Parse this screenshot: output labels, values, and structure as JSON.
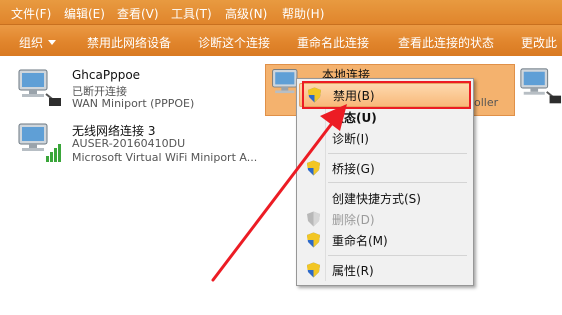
{
  "menubar": {
    "items": [
      "文件(F)",
      "编辑(E)",
      "查看(V)",
      "工具(T)",
      "高级(N)",
      "帮助(H)"
    ]
  },
  "toolbar": {
    "organize": "组织",
    "buttons": [
      "禁用此网络设备",
      "诊断这个连接",
      "重命名此连接",
      "查看此连接的状态",
      "更改此"
    ]
  },
  "adapters": [
    {
      "name": "GhcaPppoe",
      "status": "已断开连接",
      "device": "WAN Miniport (PPPOE)"
    },
    {
      "name": "无线网络连接 3",
      "status": "AUSER-20160410DU",
      "device": "Microsoft Virtual WiFi Miniport A..."
    },
    {
      "name": "本地连接",
      "device_tail": "oller"
    }
  ],
  "context_menu": {
    "items": [
      {
        "label": "禁用(B)",
        "shield": true,
        "highlighted": true
      },
      {
        "label": "状态(U)",
        "bold": true
      },
      {
        "label": "诊断(I)"
      },
      {
        "label": "桥接(G)",
        "shield": true
      },
      {
        "label": "创建快捷方式(S)"
      },
      {
        "label": "删除(D)",
        "shield": true,
        "disabled": true
      },
      {
        "label": "重命名(M)",
        "shield": true
      },
      {
        "label": "属性(R)",
        "shield": true
      }
    ]
  },
  "colors": {
    "toolbar": "#e1852c",
    "highlight_border": "#ec1c24",
    "annotation_arrow": "#ec1c24"
  }
}
